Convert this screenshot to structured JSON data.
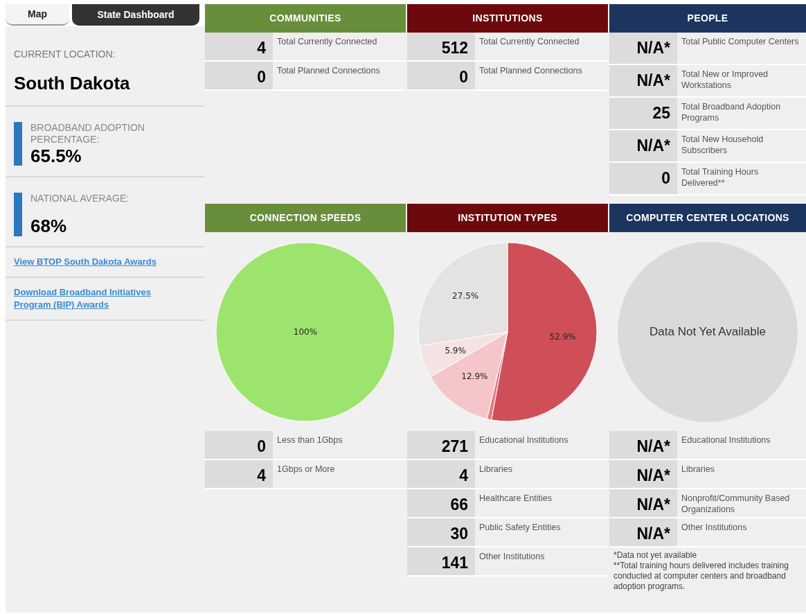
{
  "tabs": [
    {
      "label": "Map",
      "selected": false
    },
    {
      "label": "State Dashboard",
      "selected": true
    }
  ],
  "sidebar": {
    "location_label": "CURRENT LOCATION:",
    "location": "South Dakota",
    "metrics": [
      {
        "label": "BROADBAND ADOPTION PERCENTAGE:",
        "value": "65.5%"
      },
      {
        "label": "NATIONAL AVERAGE:",
        "value": "68%"
      }
    ],
    "links": [
      "View BTOP South Dakota Awards",
      "Download Broadband Initiatives Program (BIP) Awards"
    ]
  },
  "summary_panels": [
    {
      "title": "COMMUNITIES",
      "color": "#688d3b",
      "stats": [
        {
          "value": "4",
          "label": "Total Currently Connected"
        },
        {
          "value": "0",
          "label": "Total Planned Connections"
        }
      ]
    },
    {
      "title": "INSTITUTIONS",
      "color": "#6b090d",
      "stats": [
        {
          "value": "512",
          "label": "Total Currently Connected"
        },
        {
          "value": "0",
          "label": "Total Planned Connections"
        }
      ]
    },
    {
      "title": "PEOPLE",
      "color": "#1b355e",
      "stats": [
        {
          "value": "N/A*",
          "label": "Total Public Computer Centers"
        },
        {
          "value": "N/A*",
          "label": "Total New or Improved Workstations"
        },
        {
          "value": "25",
          "label": "Total Broadband Adoption Programs"
        },
        {
          "value": "N/A*",
          "label": "Total New Household Subscribers"
        },
        {
          "value": "0",
          "label": "Total Training Hours Delivered**"
        }
      ]
    }
  ],
  "detail_panels": [
    {
      "title": "CONNECTION SPEEDS",
      "color": "#688d3b",
      "chart_data": {
        "type": "pie",
        "values": [
          100
        ],
        "colors": [
          "#9de46f"
        ],
        "value_labels": [
          "100%"
        ]
      },
      "stats": [
        {
          "value": "0",
          "label": "Less than 1Gbps"
        },
        {
          "value": "4",
          "label": "1Gbps or More"
        }
      ]
    },
    {
      "title": "INSTITUTION TYPES",
      "color": "#6b090d",
      "chart_data": {
        "type": "pie",
        "values": [
          52.9,
          0.8,
          12.9,
          5.9,
          27.5
        ],
        "colors": [
          "#cf4f58",
          "#e07c84",
          "#f5c6c9",
          "#f5e3e4",
          "#e4e3e2"
        ],
        "value_labels": [
          "52.9%",
          null,
          "12.9%",
          "5.9%",
          "27.5%"
        ]
      },
      "stats": [
        {
          "value": "271",
          "label": "Educational Institutions"
        },
        {
          "value": "4",
          "label": "Libraries"
        },
        {
          "value": "66",
          "label": "Healthcare Entities"
        },
        {
          "value": "30",
          "label": "Public Safety Entities"
        },
        {
          "value": "141",
          "label": "Other Institutions"
        }
      ]
    },
    {
      "title": "COMPUTER CENTER LOCATIONS",
      "color": "#1b355e",
      "empty_chart": {
        "message": "Data Not Yet Available"
      },
      "stats": [
        {
          "value": "N/A*",
          "label": "Educational Institutions"
        },
        {
          "value": "N/A*",
          "label": "Libraries"
        },
        {
          "value": "N/A*",
          "label": "Nonprofit/Community Based Organizations"
        },
        {
          "value": "N/A*",
          "label": "Other Institutions"
        }
      ],
      "footnotes": [
        "*Data not yet available",
        "**Total training hours delivered includes training conducted at computer centers and broadband adoption programs."
      ]
    }
  ]
}
